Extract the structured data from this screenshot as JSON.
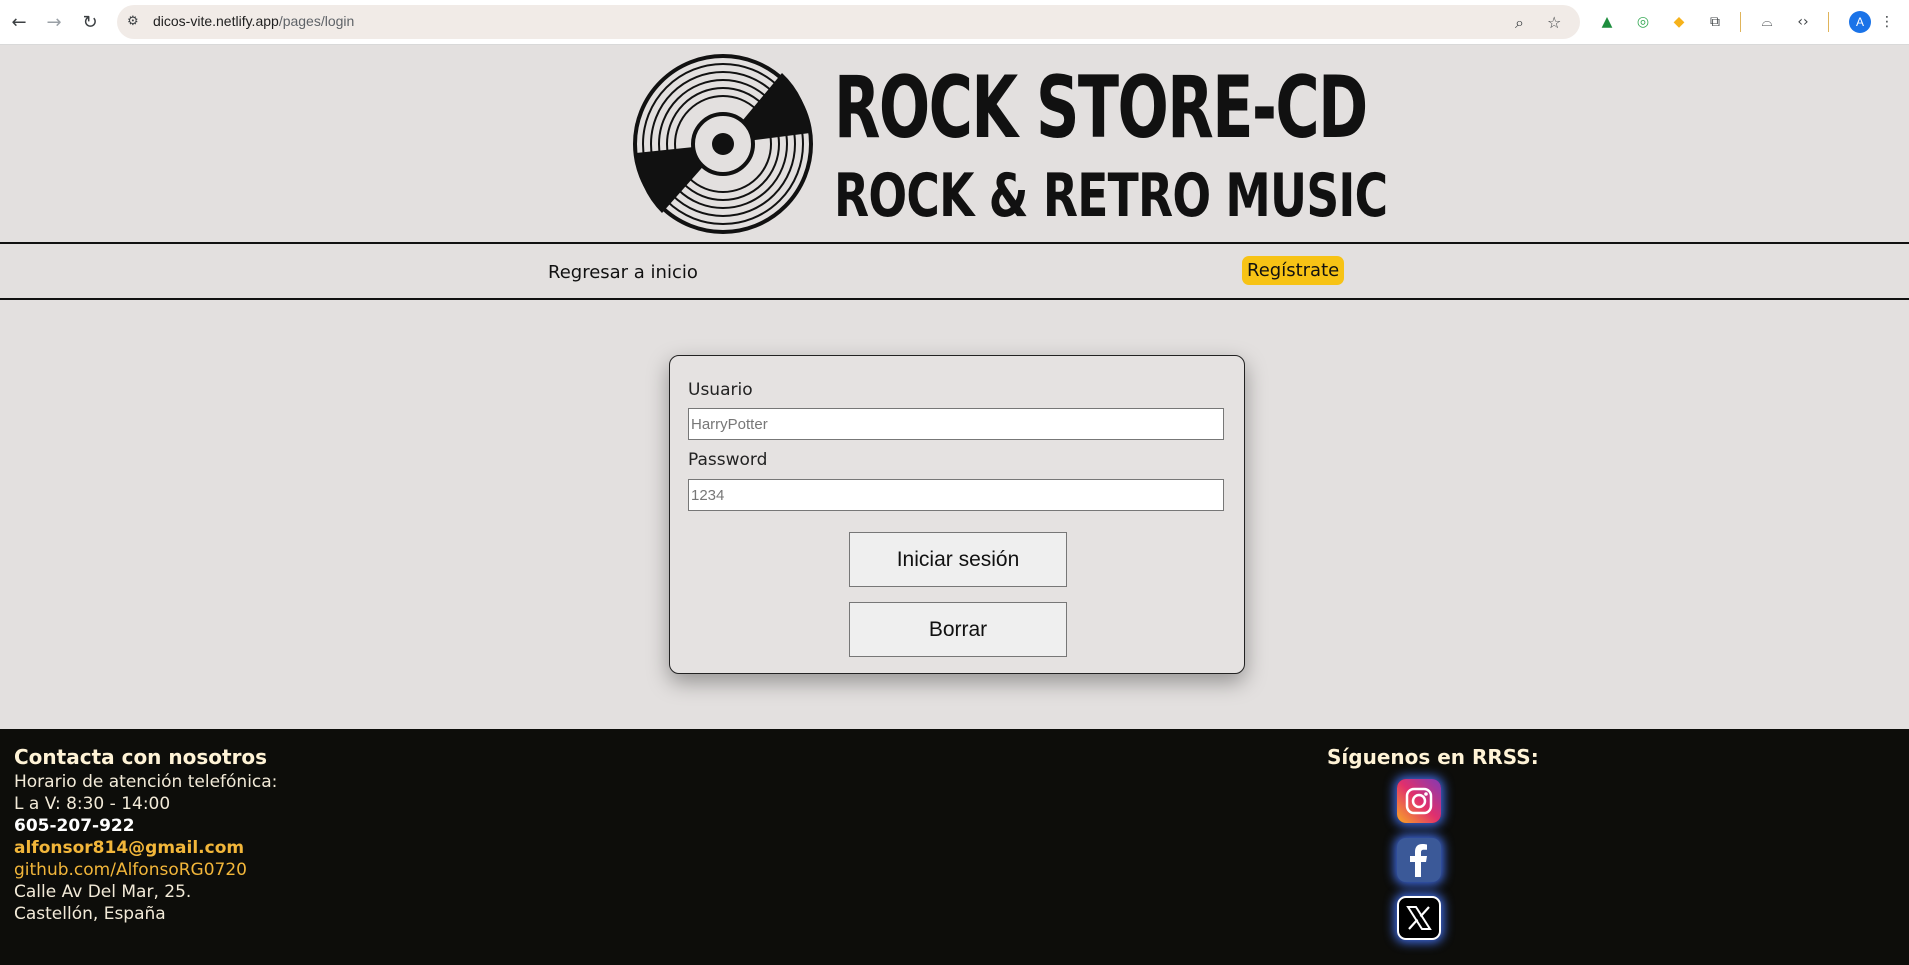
{
  "browser": {
    "url_host": "dicos-vite.netlify.app",
    "url_path": "/pages/login",
    "avatar_letter": "A"
  },
  "header": {
    "logo_title": "ROCK STORE-CD",
    "logo_subtitle": "ROCK & RETRO MUSIC"
  },
  "nav": {
    "home_label": "Regresar a inicio",
    "register_label": "Regístrate"
  },
  "login": {
    "user_label": "Usuario",
    "user_placeholder": "HarryPotter",
    "password_label": "Password",
    "password_placeholder": "1234",
    "submit_label": "Iniciar sesión",
    "clear_label": "Borrar"
  },
  "footer": {
    "contact_title": "Contacta con nosotros",
    "hours_label": "Horario de atención telefónica:",
    "hours": "L a V: 8:30 - 14:00",
    "phone": "605-207-922",
    "email": "alfonsor814@gmail.com",
    "github": "github.com/AlfonsoRG0720",
    "address_line1": "Calle Av Del Mar, 25.",
    "address_line2": "Castellón, España",
    "social_title": "Síguenos en RRSS:",
    "social_icons": [
      "instagram-icon",
      "facebook-icon",
      "x-icon"
    ]
  },
  "colors": {
    "register_bg": "#f7c315",
    "footer_bg": "#0d0d0a",
    "footer_accent": "#f2b63a",
    "page_bg": "#e3e0df"
  }
}
